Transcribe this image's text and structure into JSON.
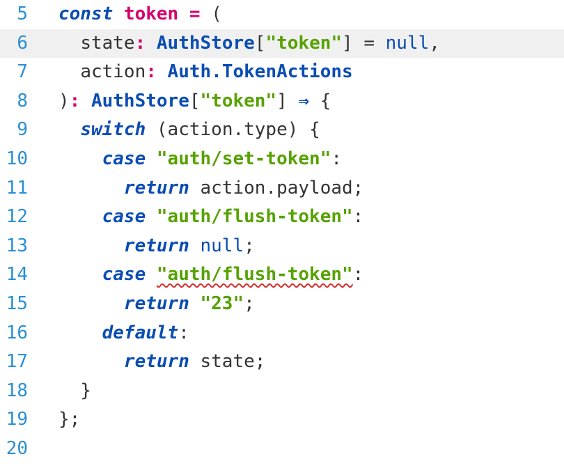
{
  "lines": {
    "l5": {
      "num": "5",
      "kw_const": "const",
      "fn": "token",
      "eq": "=",
      "paren": "("
    },
    "l6": {
      "num": "6",
      "param": "state",
      "colon": ":",
      "type": "AuthStore",
      "lb": "[",
      "str": "\"token\"",
      "rb": "]",
      "eq2": "=",
      "null": "null",
      "comma": ","
    },
    "l7": {
      "num": "7",
      "param": "action",
      "colon": ":",
      "type1": "Auth",
      "dot": ".",
      "type2": "TokenActions"
    },
    "l8": {
      "num": "8",
      "rparen": ")",
      "colon": ":",
      "type": "AuthStore",
      "lb": "[",
      "str": "\"token\"",
      "rb": "]",
      "arrow": "⇒",
      "brace": "{"
    },
    "l9": {
      "num": "9",
      "kw": "switch",
      "lp": "(",
      "obj": "action",
      "dot": ".",
      "prop": "type",
      "rp": ")",
      "brace": "{"
    },
    "l10": {
      "num": "10",
      "kw": "case",
      "str": "\"auth/set-token\"",
      "colon": ":"
    },
    "l11": {
      "num": "11",
      "kw": "return",
      "obj": "action",
      "dot": ".",
      "prop": "payload",
      "semi": ";"
    },
    "l12": {
      "num": "12",
      "kw": "case",
      "str": "\"auth/flush-token\"",
      "colon": ":"
    },
    "l13": {
      "num": "13",
      "kw": "return",
      "null": "null",
      "semi": ";"
    },
    "l14": {
      "num": "14",
      "kw": "case",
      "str": "\"auth/flush-token\"",
      "colon": ":"
    },
    "l15": {
      "num": "15",
      "kw": "return",
      "str": "\"23\"",
      "semi": ";"
    },
    "l16": {
      "num": "16",
      "kw": "default",
      "colon": ":"
    },
    "l17": {
      "num": "17",
      "kw": "return",
      "ident": "state",
      "semi": ";"
    },
    "l18": {
      "num": "18",
      "brace": "}"
    },
    "l19": {
      "num": "19",
      "brace": "}",
      "semi": ";"
    },
    "l20": {
      "num": "20"
    }
  }
}
